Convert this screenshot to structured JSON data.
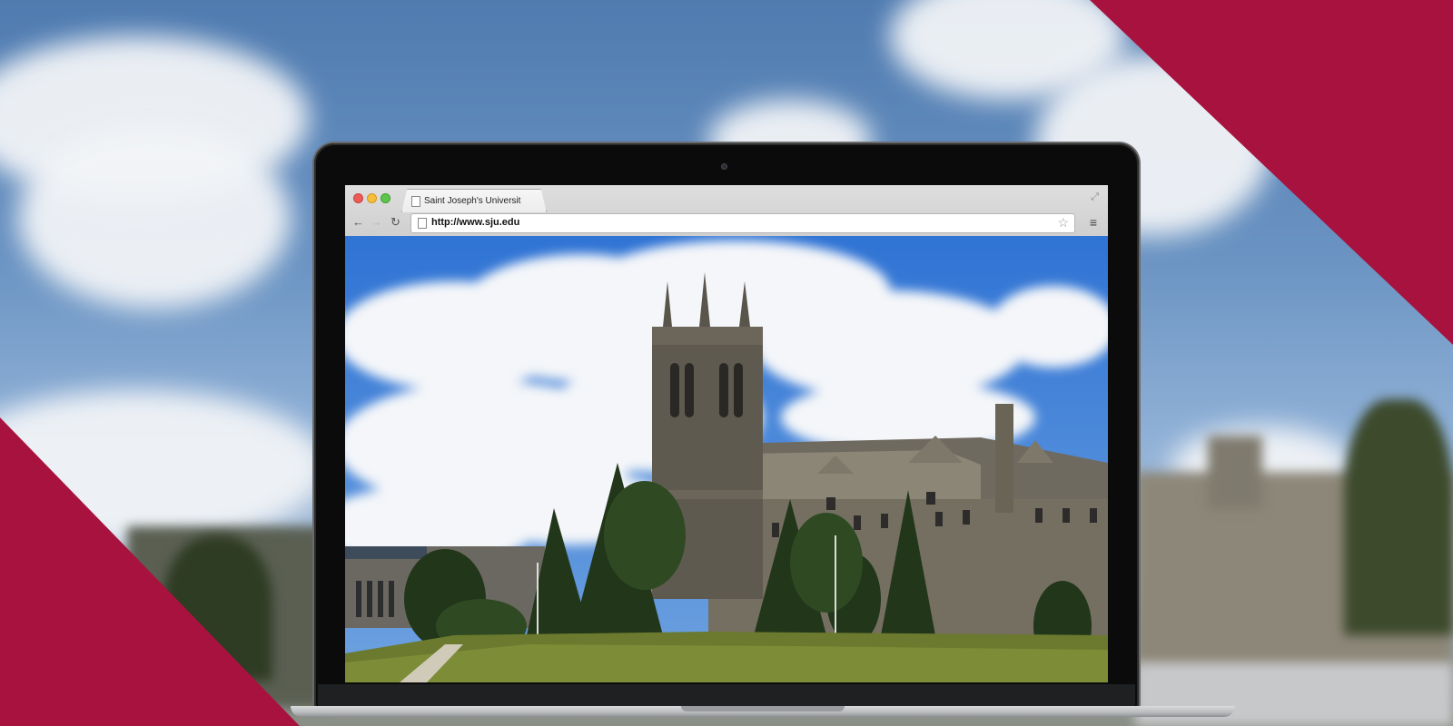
{
  "browser": {
    "tab_title": "Saint Joseph's Universit",
    "url": "http://www.sju.edu",
    "icons": [
      "page-icon",
      "fullscreen-icon",
      "back-arrow-icon",
      "forward-arrow-icon",
      "reload-icon",
      "star-icon",
      "menu-icon"
    ]
  },
  "colors": {
    "brand_red": "#a8123e",
    "sky_blue": "#3f7fd6"
  }
}
